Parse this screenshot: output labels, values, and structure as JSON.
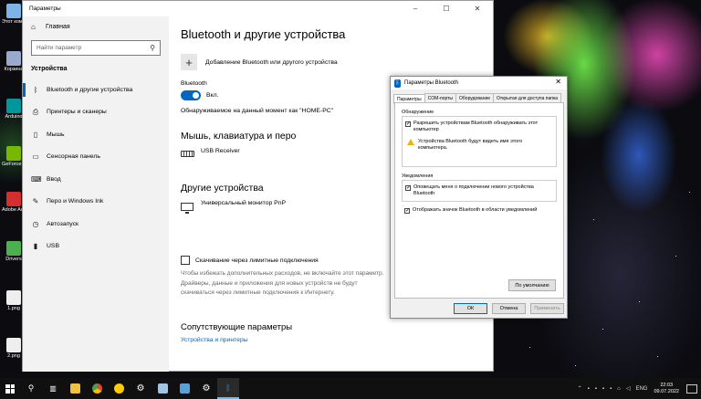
{
  "desktop": {
    "icons": [
      {
        "label": "Этот компьютер",
        "color": "#7fb2e5"
      },
      {
        "label": "Корзина",
        "color": "#9ac"
      },
      {
        "label": "Arduino",
        "color": "#00979c"
      },
      {
        "label": "GeForce Experience",
        "color": "#76b900"
      },
      {
        "label": "Adobe Acrobat",
        "color": "#d32f2f"
      },
      {
        "label": "Drivers",
        "color": "#4caf50"
      },
      {
        "label": "1.png",
        "color": "#eeeeee"
      },
      {
        "label": "2.png",
        "color": "#eeeeee"
      }
    ]
  },
  "settings": {
    "window_title": "Параметры",
    "sidebar": {
      "home_label": "Главная",
      "search_placeholder": "Найти параметр",
      "section_title": "Устройства",
      "items": [
        {
          "label": "Bluetooth и другие устройства",
          "icon": "bluetooth-icon"
        },
        {
          "label": "Принтеры и сканеры",
          "icon": "printer-icon"
        },
        {
          "label": "Мышь",
          "icon": "mouse-icon"
        },
        {
          "label": "Сенсорная панель",
          "icon": "touchpad-icon"
        },
        {
          "label": "Ввод",
          "icon": "keyboard-icon"
        },
        {
          "label": "Перо и Windows Ink",
          "icon": "pen-icon"
        },
        {
          "label": "Автозапуск",
          "icon": "autoplay-icon"
        },
        {
          "label": "USB",
          "icon": "usb-icon"
        }
      ]
    },
    "content": {
      "title": "Bluetooth и другие устройства",
      "add_label": "Добавление Bluetooth или другого устройства",
      "bluetooth_label": "Bluetooth",
      "toggle_state": "Вкл.",
      "discoverable_text": "Обнаруживаемое на данный момент как \"HOME-PC\"",
      "mkp_title": "Мышь, клавиатура и перо",
      "mkp_device": "USB Receiver",
      "other_title": "Другие устройства",
      "other_device": "Универсальный монитор PnP",
      "metered_checkbox": "Скачивание через лимитные подключения",
      "metered_desc": "Чтобы избежать дополнительных расходов, не включайте этот параметр. Драйверы, данные и приложения для новых устройств не будут скачиваться через лимитные подключения к Интернету.",
      "related_title": "Сопутствующие параметры",
      "related_link": "Устройства и принтеры"
    }
  },
  "bt_dialog": {
    "title": "Параметры Bluetooth",
    "tabs": [
      "Параметры",
      "COM-порты",
      "Оборудование",
      "Открытая для доступа папка"
    ],
    "discovery_group": "Обнаружение",
    "allow_discovery": "Разрешить устройствам Bluetooth обнаруживать этот компьютер",
    "warning_text": "Устройства Bluetooth будут видеть имя этого компьютера.",
    "notifications_group": "Уведомления",
    "notify_new": "Оповещать меня о подключении нового устройства Bluetooth",
    "show_icon": "Отображать значок Bluetooth в области уведомлений",
    "default_button": "По умолчанию",
    "ok_button": "ОК",
    "cancel_button": "Отмена",
    "apply_button": "Применить"
  },
  "taskbar": {
    "apps": [
      {
        "icon": "search-icon",
        "color": "#ffffff"
      },
      {
        "icon": "task-view-icon",
        "color": "#ffffff"
      },
      {
        "icon": "file-explorer-icon",
        "color": "#f0c040"
      },
      {
        "icon": "chrome-icon",
        "color": "#e84335"
      },
      {
        "icon": "yandex-browser-icon",
        "color": "#ffcc00"
      },
      {
        "icon": "settings-gear-icon",
        "color": "#ffffff"
      },
      {
        "icon": "device-manager-icon",
        "color": "#9ec5e8"
      },
      {
        "icon": "control-panel-icon",
        "color": "#5aa0d8"
      },
      {
        "icon": "gear-app-icon",
        "color": "#cccccc"
      },
      {
        "icon": "bluetooth-icon",
        "color": "#3a8ee6"
      }
    ],
    "lang": "ENG",
    "time": "22:03",
    "date": "09.07.2022"
  }
}
